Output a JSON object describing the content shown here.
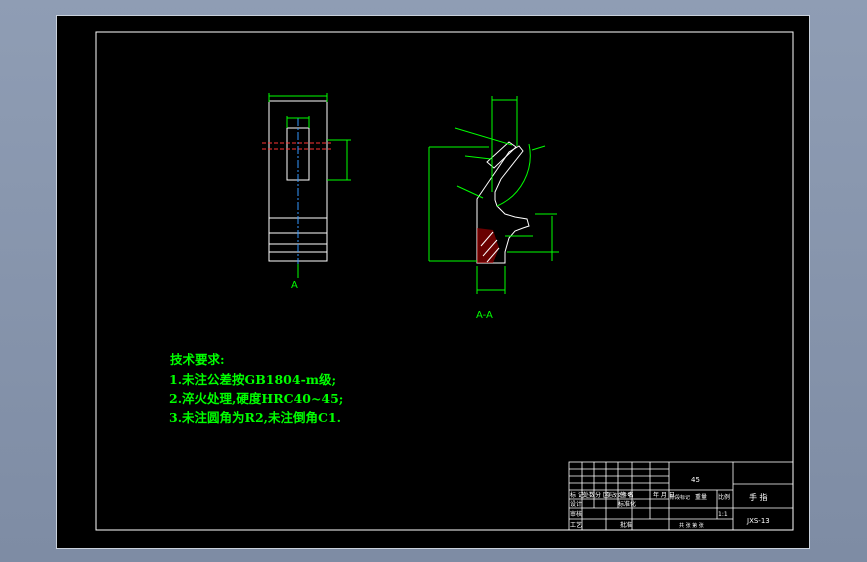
{
  "tech_requirements": {
    "title": "技术要求:",
    "items": [
      "1.未注公差按GB1804-m级;",
      "2.淬火处理,硬度HRC40~45;",
      "3.未注圆角为R2,未注倒角C1."
    ]
  },
  "section_marks": {
    "left_view_label": "A",
    "section_label": "A-A"
  },
  "title_block": {
    "material": "45",
    "part_name": "手 指",
    "drawing_no": "JXS-13",
    "scale": "1:1",
    "headers": {
      "mark": "标 记",
      "count": "处数",
      "zone": "分 区",
      "doc_no": "更改文件号",
      "sign": "签 名",
      "date": "年 月 日",
      "designer": "设计",
      "standardization": "标准化",
      "stage_mark": "阶段标记",
      "weight": "重量",
      "scale_label": "比例",
      "review": "审核",
      "process": "工艺",
      "approve": "批准",
      "sheet_info": "共 张 第 张"
    }
  },
  "colors": {
    "sheet_bg": "#000000",
    "frame": "#ffffff",
    "geometry": "#ffffff",
    "dimension": "#00ff00",
    "notes": "#00ff00",
    "center_line": "#3399ff",
    "hidden_hole": "#ff3333",
    "window_bg": "#8f9db4"
  }
}
